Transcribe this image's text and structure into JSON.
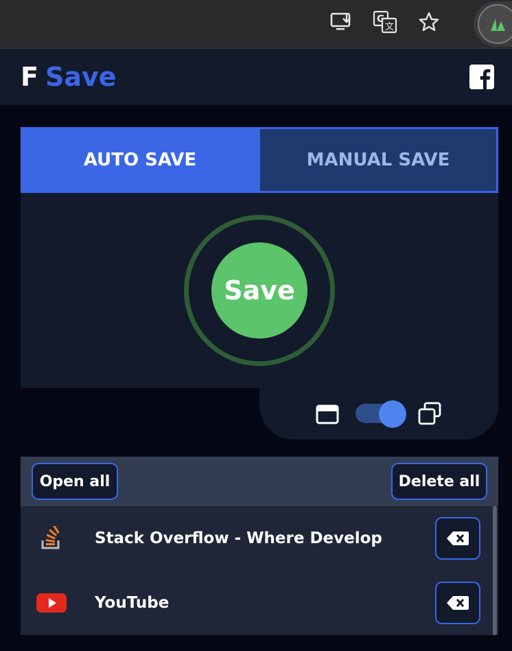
{
  "browser": {
    "icons": [
      "install-app-icon",
      "translate-icon",
      "bookmark-star-icon",
      "extension-avatar-icon"
    ]
  },
  "header": {
    "logo_letter": "F",
    "logo_word": "Save",
    "brand_color": "#3b66e6",
    "social_icon": "facebook-icon"
  },
  "tabs": [
    {
      "label": "AUTO SAVE",
      "active": true
    },
    {
      "label": "MANUAL SAVE",
      "active": false
    }
  ],
  "save_button": {
    "label": "Save",
    "color": "#5cc46a"
  },
  "mode_toggle": {
    "left_icon": "single-window-icon",
    "right_icon": "multiple-windows-icon",
    "state": "on"
  },
  "actions": {
    "open_all": "Open all",
    "delete_all": "Delete all"
  },
  "saved_tabs": [
    {
      "title": "Stack Overflow - Where Develop....",
      "icon": "stackoverflow-icon"
    },
    {
      "title": "YouTube",
      "icon": "youtube-icon"
    }
  ],
  "delete_icon": "backspace-delete-icon"
}
